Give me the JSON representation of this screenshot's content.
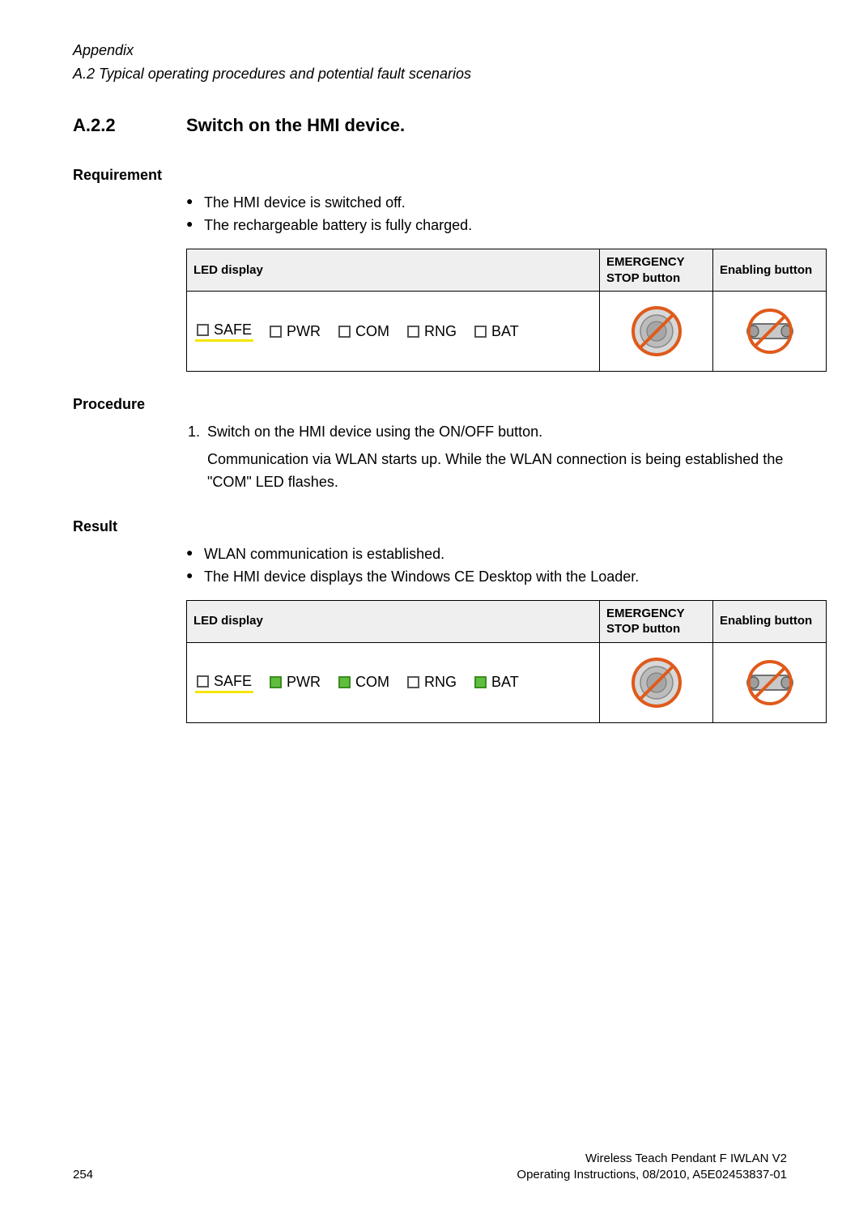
{
  "header": {
    "appendix": "Appendix",
    "section_path": "A.2 Typical operating procedures and potential fault scenarios"
  },
  "section": {
    "number": "A.2.2",
    "title": "Switch on the HMI device."
  },
  "requirement": {
    "heading": "Requirement",
    "items": [
      "The HMI device is switched off.",
      "The rechargeable battery is fully charged."
    ]
  },
  "procedure": {
    "heading": "Procedure",
    "step1": "Switch on the HMI device using the ON/OFF button.",
    "step1_detail": "Communication via WLAN starts up. While the WLAN connection is being established the \"COM\" LED flashes."
  },
  "result": {
    "heading": "Result",
    "items": [
      "WLAN communication is established.",
      "The HMI device displays the Windows CE Desktop with the Loader."
    ]
  },
  "table_headers": {
    "led": "LED display",
    "estop": "EMERGENCY STOP button",
    "enable": "Enabling button"
  },
  "leds": {
    "safe": "SAFE",
    "pwr": "PWR",
    "com": "COM",
    "rng": "RNG",
    "bat": "BAT"
  },
  "footer": {
    "page": "254",
    "title": "Wireless Teach Pendant F IWLAN V2",
    "doc": "Operating Instructions, 08/2010, A5E02453837-01"
  }
}
